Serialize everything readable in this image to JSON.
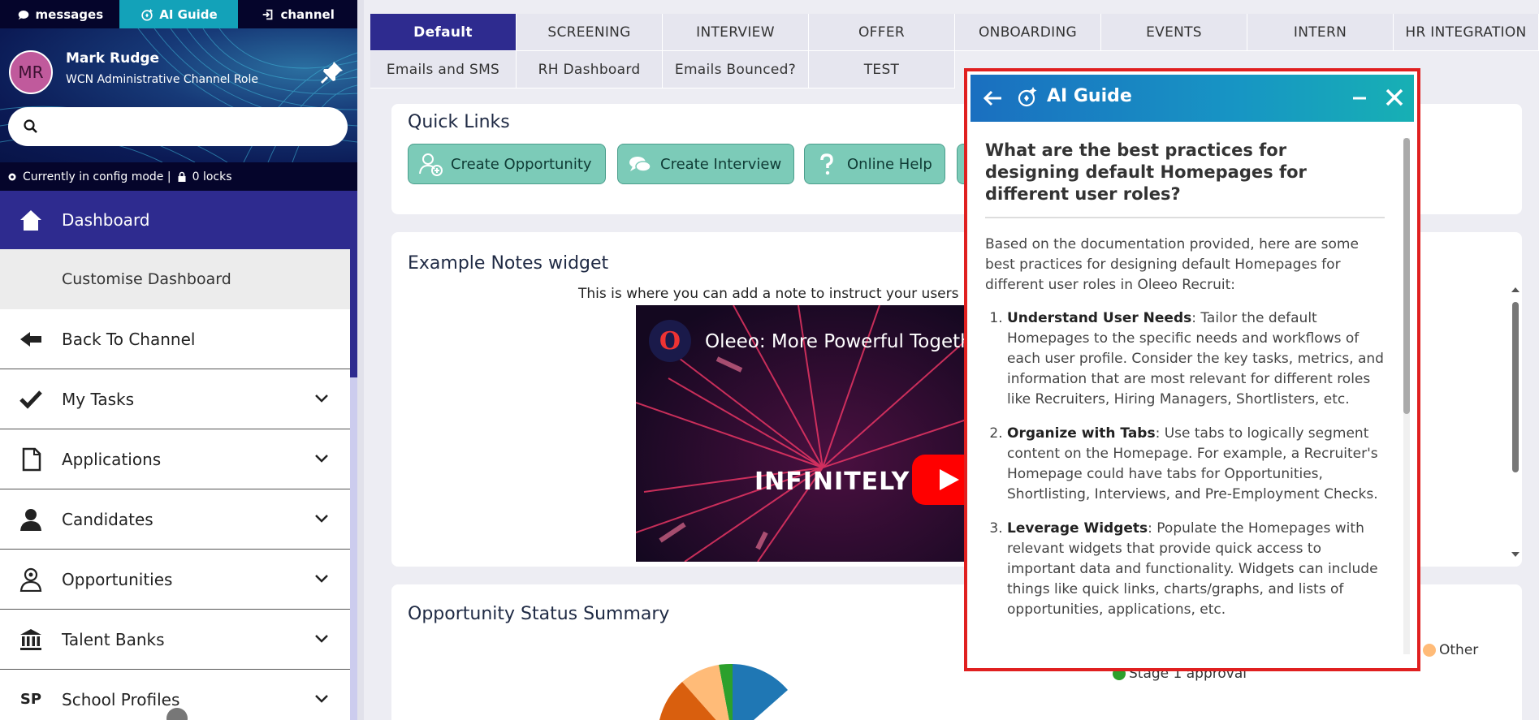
{
  "topnav": {
    "messages": "messages",
    "ai_guide": "AI Guide",
    "channel": "channel"
  },
  "user": {
    "initials": "MR",
    "name": "Mark Rudge",
    "role": "WCN Administrative Channel Role"
  },
  "search": {
    "placeholder": "",
    "value": ""
  },
  "config": {
    "mode_text": "Currently in config mode |",
    "locks_text": "0 locks"
  },
  "sidebar": {
    "dashboard": "Dashboard",
    "customise": "Customise Dashboard",
    "back": "Back To Channel",
    "items": [
      {
        "label": "My Tasks"
      },
      {
        "label": "Applications"
      },
      {
        "label": "Candidates"
      },
      {
        "label": "Opportunities"
      },
      {
        "label": "Talent Banks"
      },
      {
        "label": "School Profiles",
        "prefix": "SP"
      }
    ]
  },
  "tabs": {
    "row1": [
      "Default",
      "SCREENING",
      "INTERVIEW",
      "OFFER",
      "ONBOARDING",
      "EVENTS",
      "INTERN",
      "HR INTEGRATION"
    ],
    "row2": [
      "Emails and SMS",
      "RH Dashboard",
      "Emails Bounced?",
      "TEST"
    ],
    "active": "Default"
  },
  "quick_links": {
    "title": "Quick Links",
    "buttons": [
      "Create Opportunity",
      "Create Interview",
      "Online Help"
    ]
  },
  "notes": {
    "title": "Example Notes widget",
    "text": "This is where you can add a note to instruct your users",
    "video_title": "Oleeo: More Powerful Together",
    "video_big": "INFINITELY",
    "video_logo": "O"
  },
  "status_summary": {
    "title": "Opportunity Status Summary",
    "legend": [
      "Other",
      "Stage 1 approval"
    ]
  },
  "colors": {
    "brand": "#2e2b8f",
    "teal": "#13a2b9",
    "quick_link": "#7ccbb8",
    "panel_border": "#e02020"
  },
  "ai_guide": {
    "title": "AI Guide",
    "question": "What are the best practices for designing default Homepages for different user roles?",
    "intro": "Based on the documentation provided, here are some best practices for designing default Homepages for different user roles in Oleeo Recruit:",
    "points": [
      {
        "title": "Understand User Needs",
        "text": ": Tailor the default Homepages to the specific needs and workflows of each user profile. Consider the key tasks, metrics, and information that are most relevant for different roles like Recruiters, Hiring Managers, Shortlisters, etc."
      },
      {
        "title": "Organize with Tabs",
        "text": ": Use tabs to logically segment content on the Homepage. For example, a Recruiter's Homepage could have tabs for Opportunities, Shortlisting, Interviews, and Pre-Employment Checks."
      },
      {
        "title": "Leverage Widgets",
        "text": ": Populate the Homepages with relevant widgets that provide quick access to important data and functionality. Widgets can include things like quick links, charts/graphs, and lists of opportunities, applications, etc."
      }
    ]
  }
}
